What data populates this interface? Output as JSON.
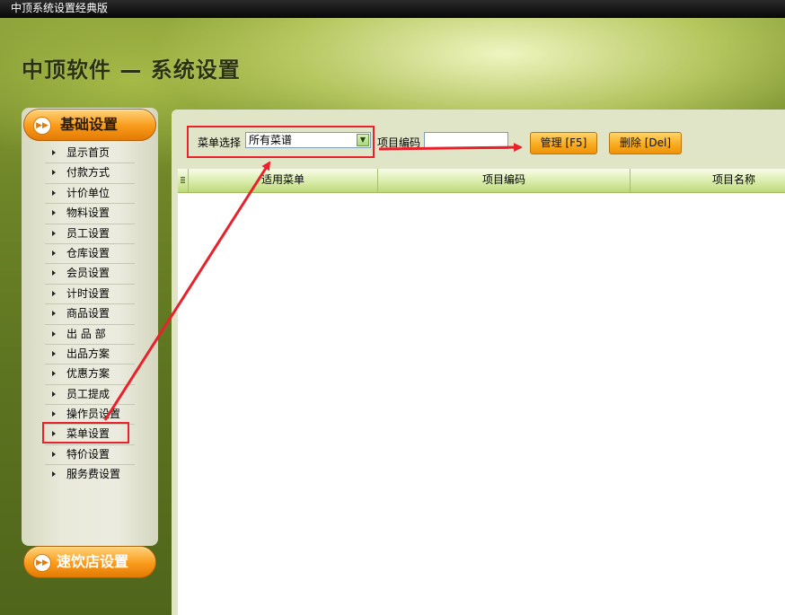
{
  "window": {
    "title": "中顶系统设置经典版"
  },
  "page_title": "中顶软件 — 系统设置",
  "sidebar": {
    "top_button": "基础设置",
    "bottom_button": "速饮店设置",
    "items": [
      {
        "label": "显示首页"
      },
      {
        "label": "付款方式"
      },
      {
        "label": "计价单位"
      },
      {
        "label": "物料设置"
      },
      {
        "label": "员工设置"
      },
      {
        "label": "仓库设置"
      },
      {
        "label": "会员设置"
      },
      {
        "label": "计时设置"
      },
      {
        "label": "商品设置"
      },
      {
        "label": "出 品 部"
      },
      {
        "label": "出品方案"
      },
      {
        "label": "优惠方案"
      },
      {
        "label": "员工提成"
      },
      {
        "label": "操作员设置"
      },
      {
        "label": "菜单设置"
      },
      {
        "label": "特价设置"
      },
      {
        "label": "服务费设置"
      }
    ],
    "selected": "菜单设置"
  },
  "toolbar": {
    "menu_select_label": "菜单选择",
    "menu_select_value": "所有菜谱",
    "item_code_label": "项目编码",
    "item_code_value": "",
    "manage_button": "管理 [F5]",
    "delete_button": "删除 [Del]"
  },
  "grid": {
    "columns": [
      "适用菜单",
      "项目编码",
      "项目名称"
    ],
    "rows": []
  },
  "colors": {
    "accent_orange": "#f99a1a",
    "annotation_red": "#e8212c",
    "grid_header_green": "#d9ecaa"
  }
}
